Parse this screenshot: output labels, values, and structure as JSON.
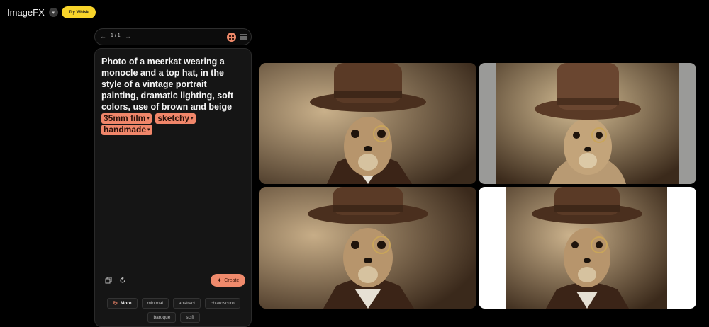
{
  "header": {
    "brand": "ImageFX",
    "brand_menu_icon": "chevron-down-icon",
    "try_button": "Try Whisk"
  },
  "pager": {
    "count": "1 / 1",
    "prev_icon": "arrow-left-icon",
    "next_icon": "arrow-right-icon",
    "grid_view_icon": "grid-icon",
    "list_view_icon": "list-icon"
  },
  "prompt": {
    "text": "Photo of a meerkat wearing a monocle and a top hat, in the style of a vintage portrait painting, dramatic lighting, soft colors, use of brown and beige",
    "chips": [
      {
        "label": "35mm film"
      },
      {
        "label": "sketchy"
      },
      {
        "label": "handmade"
      }
    ]
  },
  "actions": {
    "copy_icon": "copy-icon",
    "refresh_icon": "refresh-icon",
    "create_label": "Create"
  },
  "style_chips": {
    "more": "More",
    "items": [
      "minimal",
      "abstract",
      "chiaroscuro",
      "baroque",
      "scifi"
    ]
  },
  "colors": {
    "accent": "#f0866a",
    "try_button": "#f8d42a",
    "background": "#000000",
    "panel": "#151515"
  },
  "images": [
    {
      "subject": "meerkat-top-hat-monocle"
    },
    {
      "subject": "meerkat-top-hat-monocle"
    },
    {
      "subject": "meerkat-top-hat-monocle"
    },
    {
      "subject": "meerkat-top-hat-monocle"
    }
  ]
}
